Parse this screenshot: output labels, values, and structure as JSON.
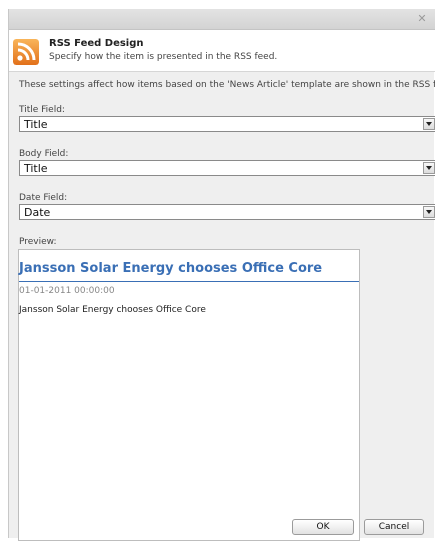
{
  "window": {
    "close_icon": "close-x-icon"
  },
  "header": {
    "title": "RSS Feed Design",
    "subtitle": "Specify how the item is presented in the RSS feed.",
    "icon": "rss-feed-icon",
    "icon_color": "#f08a24"
  },
  "intro": "These settings affect how items based on the 'News Article' template are shown in the RSS feed.",
  "fields": {
    "title": {
      "label": "Title Field:",
      "value": "Title"
    },
    "body": {
      "label": "Body Field:",
      "value": "Title"
    },
    "date": {
      "label": "Date Field:",
      "value": "Date"
    }
  },
  "preview": {
    "label": "Preview:",
    "title": "Jansson Solar Energy chooses Office Core",
    "date": "01-01-2011 00:00:00",
    "body": "Jansson Solar Energy chooses Office Core",
    "title_color": "#3a6fb5"
  },
  "buttons": {
    "ok": "OK",
    "cancel": "Cancel"
  }
}
